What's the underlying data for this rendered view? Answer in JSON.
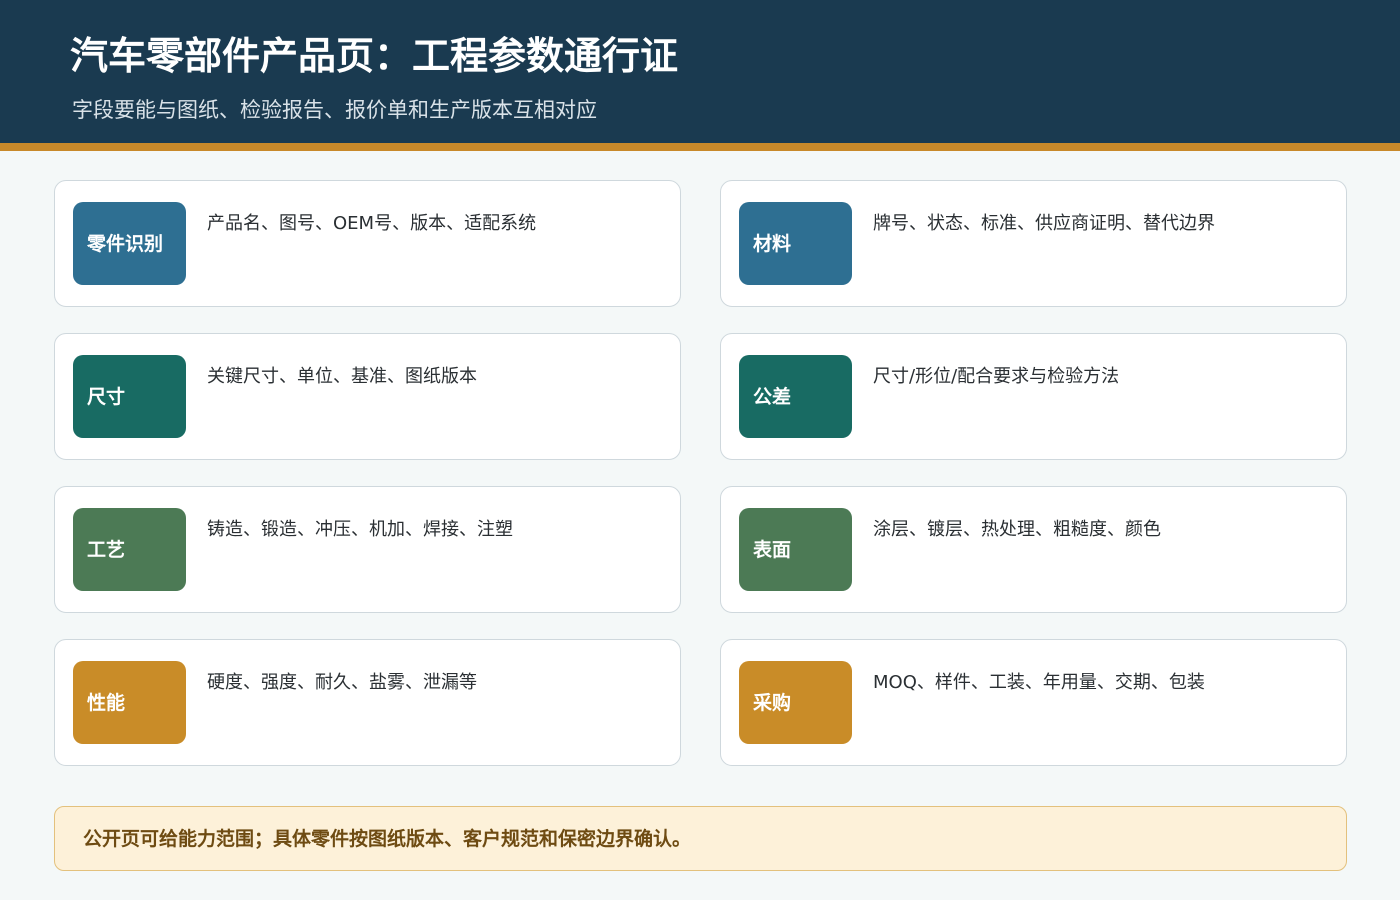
{
  "header": {
    "title": "汽车零部件产品页：工程参数通行证",
    "subtitle": "字段要能与图纸、检验报告、报价单和生产版本互相对应"
  },
  "cards": [
    {
      "tag": "零件识别",
      "desc": "产品名、图号、OEM号、版本、适配系统",
      "color": "#2e6f92"
    },
    {
      "tag": "材料",
      "desc": "牌号、状态、标准、供应商证明、替代边界",
      "color": "#2e6f92"
    },
    {
      "tag": "尺寸",
      "desc": "关键尺寸、单位、基准、图纸版本",
      "color": "#186b63"
    },
    {
      "tag": "公差",
      "desc": "尺寸/形位/配合要求与检验方法",
      "color": "#186b63"
    },
    {
      "tag": "工艺",
      "desc": "铸造、锻造、冲压、机加、焊接、注塑",
      "color": "#4c7a55"
    },
    {
      "tag": "表面",
      "desc": "涂层、镀层、热处理、粗糙度、颜色",
      "color": "#4c7a55"
    },
    {
      "tag": "性能",
      "desc": "硬度、强度、耐久、盐雾、泄漏等",
      "color": "#c98c28"
    },
    {
      "tag": "采购",
      "desc": "MOQ、样件、工装、年用量、交期、包装",
      "color": "#c98c28"
    }
  ],
  "note": "公开页可给能力范围；具体零件按图纸版本、客户规范和保密边界确认。"
}
